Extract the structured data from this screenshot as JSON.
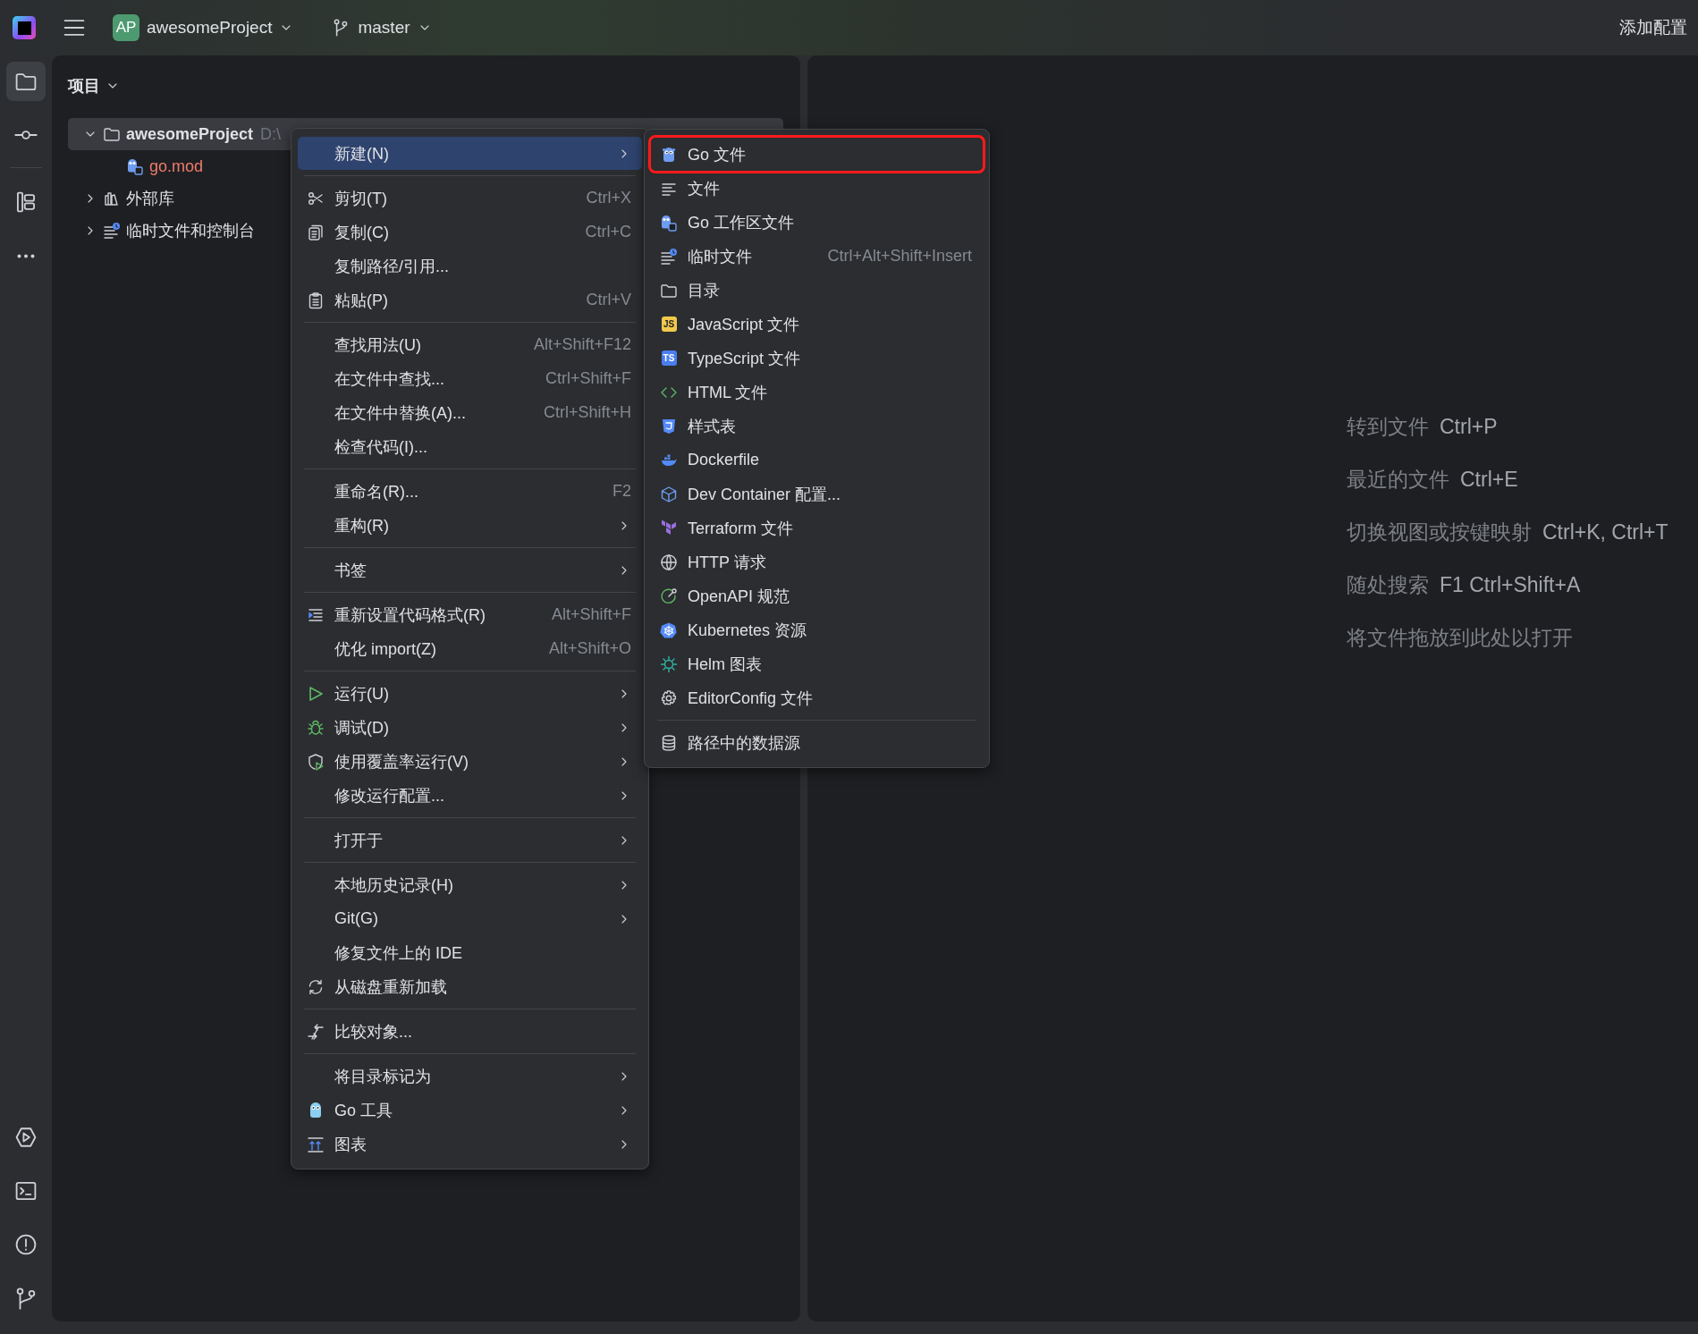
{
  "toolbar": {
    "project_badge": "AP",
    "project": "awesomeProject",
    "branch": "master",
    "run_config": "添加配置"
  },
  "tool_strip": [
    {
      "selected": true
    },
    {
      "selected": false
    },
    {
      "selected": false
    },
    {
      "selected": false
    },
    {
      "selected": false
    },
    {
      "selected": false
    },
    {
      "selected": false
    },
    {
      "selected": false
    }
  ],
  "project_panel": {
    "title": "项目",
    "tree": [
      {
        "label": "awesomeProject",
        "path": "D:\\",
        "expanded": true,
        "selected": true,
        "children": [
          {
            "label": "go.mod",
            "color": "#ee7b6a",
            "selected": false
          }
        ]
      },
      {
        "label": "外部库",
        "expanded": false,
        "selected": false
      },
      {
        "label": "临时文件和控制台",
        "expanded": false,
        "selected": false
      }
    ]
  },
  "editor": {
    "hints": [
      {
        "label": "转到文件",
        "shortcut": "Ctrl+P"
      },
      {
        "label": "最近的文件",
        "shortcut": "Ctrl+E"
      },
      {
        "label": "切换视图或按键映射",
        "shortcut": "Ctrl+K, Ctrl+T"
      },
      {
        "label": "随处搜索",
        "shortcut": "F1 Ctrl+Shift+A"
      },
      {
        "label": "将文件拖放到此处以打开"
      }
    ]
  },
  "context_menu": {
    "items": [
      {
        "kind": "item",
        "label": "新建(N)",
        "submenu": true,
        "selected": true
      },
      {
        "kind": "separator"
      },
      {
        "kind": "item",
        "label": "剪切(T)",
        "shortcut": "Ctrl+X",
        "submenu": false,
        "selected": false
      },
      {
        "kind": "item",
        "label": "复制(C)",
        "shortcut": "Ctrl+C",
        "submenu": false,
        "selected": false
      },
      {
        "kind": "item",
        "label": "复制路径/引用...",
        "submenu": false,
        "selected": false
      },
      {
        "kind": "item",
        "label": "粘贴(P)",
        "shortcut": "Ctrl+V",
        "submenu": false,
        "selected": false
      },
      {
        "kind": "separator"
      },
      {
        "kind": "item",
        "label": "查找用法(U)",
        "shortcut": "Alt+Shift+F12",
        "submenu": false,
        "selected": false
      },
      {
        "kind": "item",
        "label": "在文件中查找...",
        "shortcut": "Ctrl+Shift+F",
        "submenu": false,
        "selected": false
      },
      {
        "kind": "item",
        "label": "在文件中替换(A)...",
        "shortcut": "Ctrl+Shift+H",
        "submenu": false,
        "selected": false
      },
      {
        "kind": "item",
        "label": "检查代码(I)...",
        "submenu": false,
        "selected": false
      },
      {
        "kind": "separator"
      },
      {
        "kind": "item",
        "label": "重命名(R)...",
        "shortcut": "F2",
        "submenu": false,
        "selected": false
      },
      {
        "kind": "item",
        "label": "重构(R)",
        "submenu": true,
        "selected": false
      },
      {
        "kind": "separator"
      },
      {
        "kind": "item",
        "label": "书签",
        "submenu": true,
        "selected": false
      },
      {
        "kind": "separator"
      },
      {
        "kind": "item",
        "label": "重新设置代码格式(R)",
        "shortcut": "Alt+Shift+F",
        "submenu": false,
        "selected": false
      },
      {
        "kind": "item",
        "label": "优化 import(Z)",
        "shortcut": "Alt+Shift+O",
        "submenu": false,
        "selected": false
      },
      {
        "kind": "separator"
      },
      {
        "kind": "item",
        "label": "运行(U)",
        "submenu": true,
        "selected": false
      },
      {
        "kind": "item",
        "label": "调试(D)",
        "submenu": true,
        "selected": false
      },
      {
        "kind": "item",
        "label": "使用覆盖率运行(V)",
        "submenu": true,
        "selected": false
      },
      {
        "kind": "item",
        "label": "修改运行配置...",
        "submenu": true,
        "selected": false
      },
      {
        "kind": "separator"
      },
      {
        "kind": "item",
        "label": "打开于",
        "submenu": true,
        "selected": false
      },
      {
        "kind": "separator"
      },
      {
        "kind": "item",
        "label": "本地历史记录(H)",
        "submenu": true,
        "selected": false
      },
      {
        "kind": "item",
        "label": "Git(G)",
        "submenu": true,
        "selected": false
      },
      {
        "kind": "item",
        "label": "修复文件上的 IDE",
        "submenu": false,
        "selected": false
      },
      {
        "kind": "item",
        "label": "从磁盘重新加载",
        "submenu": false,
        "selected": false
      },
      {
        "kind": "separator"
      },
      {
        "kind": "item",
        "label": "比较对象...",
        "submenu": false,
        "selected": false
      },
      {
        "kind": "separator"
      },
      {
        "kind": "item",
        "label": "将目录标记为",
        "submenu": true,
        "selected": false
      },
      {
        "kind": "item",
        "label": "Go 工具",
        "submenu": true,
        "selected": false
      },
      {
        "kind": "item",
        "label": "图表",
        "submenu": true,
        "selected": false
      }
    ]
  },
  "submenu": {
    "items": [
      {
        "kind": "item",
        "label": "Go 文件",
        "selected": false,
        "outlined": true
      },
      {
        "kind": "item",
        "label": "文件",
        "selected": false,
        "outlined": false
      },
      {
        "kind": "item",
        "label": "Go 工作区文件",
        "selected": false,
        "outlined": false
      },
      {
        "kind": "item",
        "label": "临时文件",
        "shortcut": "Ctrl+Alt+Shift+Insert",
        "selected": false,
        "outlined": false
      },
      {
        "kind": "item",
        "label": "目录",
        "selected": false,
        "outlined": false
      },
      {
        "kind": "item",
        "label": "JavaScript 文件",
        "icon_text": "JS",
        "selected": false,
        "outlined": false
      },
      {
        "kind": "item",
        "label": "TypeScript 文件",
        "icon_text": "TS",
        "selected": false,
        "outlined": false
      },
      {
        "kind": "item",
        "label": "HTML 文件",
        "selected": false,
        "outlined": false
      },
      {
        "kind": "item",
        "label": "样式表",
        "selected": false,
        "outlined": false
      },
      {
        "kind": "item",
        "label": "Dockerfile",
        "selected": false,
        "outlined": false
      },
      {
        "kind": "item",
        "label": "Dev Container 配置...",
        "selected": false,
        "outlined": false
      },
      {
        "kind": "item",
        "label": "Terraform 文件",
        "selected": false,
        "outlined": false
      },
      {
        "kind": "item",
        "label": "HTTP 请求",
        "selected": false,
        "outlined": false
      },
      {
        "kind": "item",
        "label": "OpenAPI 规范",
        "selected": false,
        "outlined": false
      },
      {
        "kind": "item",
        "label": "Kubernetes 资源",
        "selected": false,
        "outlined": false
      },
      {
        "kind": "item",
        "label": "Helm 图表",
        "selected": false,
        "outlined": false
      },
      {
        "kind": "item",
        "label": "EditorConfig 文件",
        "selected": false,
        "outlined": false
      },
      {
        "kind": "separator"
      },
      {
        "kind": "item",
        "label": "路径中的数据源",
        "selected": false,
        "outlined": false
      }
    ]
  }
}
